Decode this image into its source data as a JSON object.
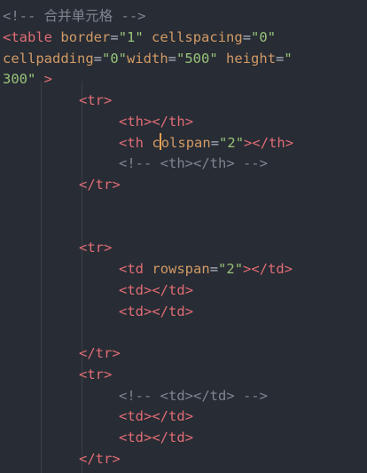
{
  "lines": [
    {
      "t0": "<!-- ",
      "t1": "合并单元格",
      "t2": " -->"
    },
    {
      "t0": "<",
      "t1": "table",
      "t2": " ",
      "t3": "border",
      "t4": "=",
      "t5": "\"1\"",
      "t6": " ",
      "t7": "cellspacing",
      "t8": "=",
      "t9": "\"0\""
    },
    {
      "t0": "cellpadding",
      "t1": "=",
      "t2": "\"0\"",
      "t3": "width",
      "t4": "=",
      "t5": "\"500\"",
      "t6": " ",
      "t7": "height",
      "t8": "=",
      "t9": "\""
    },
    {
      "t0": "300\"",
      "t1": " >"
    },
    {
      "t0": "<",
      "t1": "tr",
      "t2": ">"
    },
    {
      "t0": "<",
      "t1": "th",
      "t2": "></",
      "t3": "th",
      "t4": ">"
    },
    {
      "t0": "<",
      "t1": "th",
      "t2": " ",
      "t3a": "c",
      "t3b": "olspan",
      "t4": "=",
      "t5": "\"2\"",
      "t6": "></",
      "t7": "th",
      "t8": ">"
    },
    {
      "t0": "<!-- <th></th> -->"
    },
    {
      "t0": "</",
      "t1": "tr",
      "t2": ">"
    },
    {
      "t0": "<",
      "t1": "tr",
      "t2": ">"
    },
    {
      "t0": "<",
      "t1": "td",
      "t2": " ",
      "t3": "rowspan",
      "t4": "=",
      "t5": "\"2\"",
      "t6": "></",
      "t7": "td",
      "t8": ">"
    },
    {
      "t0": "<",
      "t1": "td",
      "t2": "></",
      "t3": "td",
      "t4": ">"
    },
    {
      "t0": "<",
      "t1": "td",
      "t2": "></",
      "t3": "td",
      "t4": ">"
    },
    {
      "t0": "</",
      "t1": "tr",
      "t2": ">"
    },
    {
      "t0": "<",
      "t1": "tr",
      "t2": ">"
    },
    {
      "t0": "<!-- <td></td> -->"
    },
    {
      "t0": "<",
      "t1": "td",
      "t2": "></",
      "t3": "td",
      "t4": ">"
    },
    {
      "t0": "<",
      "t1": "td",
      "t2": "></",
      "t3": "td",
      "t4": ">"
    },
    {
      "t0": "</",
      "t1": "tr",
      "t2": ">"
    }
  ]
}
